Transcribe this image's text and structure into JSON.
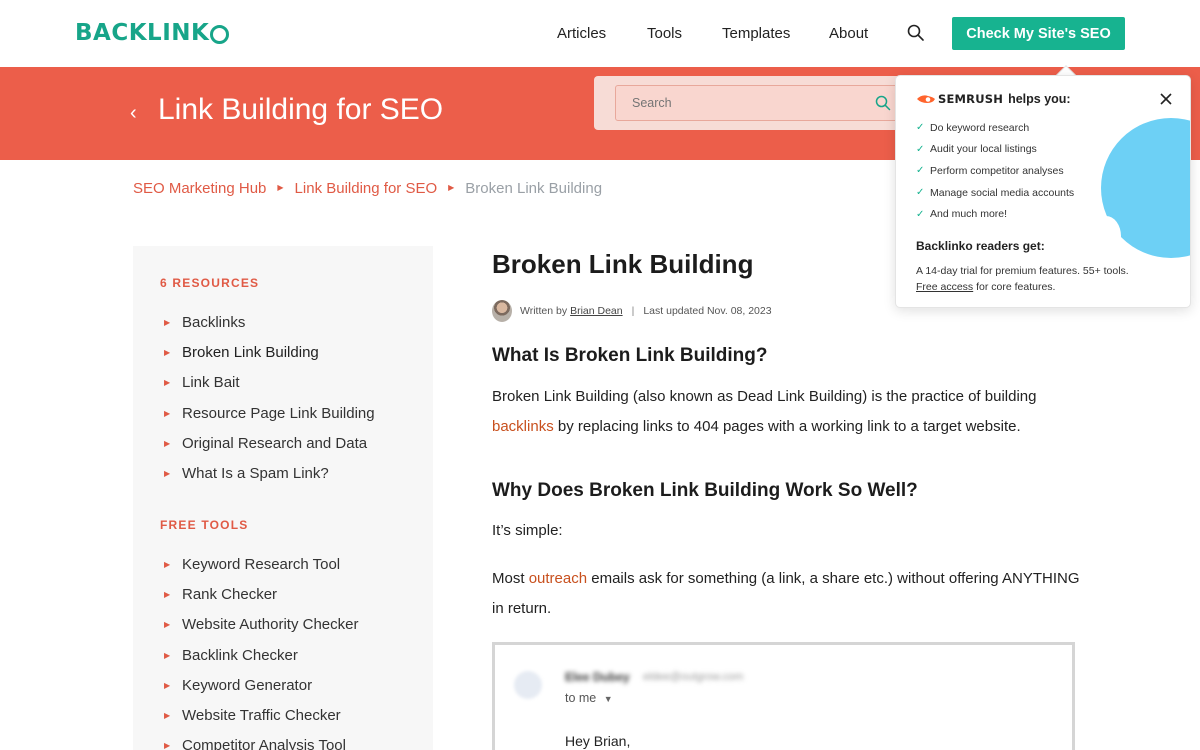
{
  "header": {
    "logo": "BACKLINK",
    "nav": [
      "Articles",
      "Tools",
      "Templates",
      "About"
    ],
    "cta_label": "Check My Site's SEO",
    "colors": {
      "brand": "#17a589",
      "cta": "#17b390",
      "hero": "#ec5e4a",
      "accent_link": "#c8501e"
    }
  },
  "hero": {
    "back_icon": "chevron-left-icon",
    "title": "Link Building for SEO",
    "search_placeholder": "Search"
  },
  "breadcrumb": {
    "items": [
      "SEO Marketing Hub",
      "Link Building for SEO"
    ],
    "current": "Broken Link Building"
  },
  "sidebar": {
    "resources_heading": "6 RESOURCES",
    "resources": [
      "Backlinks",
      "Broken Link Building",
      "Link Bait",
      "Resource Page Link Building",
      "Original Research and Data",
      "What Is a Spam Link?"
    ],
    "tools_heading": "FREE TOOLS",
    "tools": [
      "Keyword Research Tool",
      "Rank Checker",
      "Website Authority Checker",
      "Backlink Checker",
      "Keyword Generator",
      "Website Traffic Checker",
      "Competitor Analysis Tool"
    ]
  },
  "article": {
    "title": "Broken Link Building",
    "byline": {
      "written_by": "Written by",
      "author": "Brian Dean",
      "separator": "|",
      "updated": "Last updated Nov. 08, 2023"
    },
    "h2_1": "What Is Broken Link Building?",
    "p1_start": "Broken Link Building (also known as Dead Link Building) is the practice of building",
    "p1_link": "backlinks",
    "p1_end": " by replacing links to 404 pages with a working link to a target website.",
    "h2_2": "Why Does Broken Link Building Work So Well?",
    "p2": "It’s simple:",
    "p3_start": "Most ",
    "p3_link": "outreach",
    "p3_end": " emails ask for something (a link, a share etc.) without offering ANYTHING in return.",
    "email": {
      "sender": "Elee Dubey",
      "address": "eldee@outgrow.com",
      "to": "to me",
      "greeting": "Hey Brian,"
    }
  },
  "popover": {
    "brand": "SEMRUSH",
    "helps": "helps you:",
    "items": [
      "Do keyword research",
      "Audit your local listings",
      "Perform competitor analyses",
      "Manage social media accounts",
      "And much more!"
    ],
    "readers_heading": "Backlinko readers get:",
    "desc_line1": "A 14-day trial for premium features. 55+ tools.",
    "desc_link": "Free access",
    "desc_line2_end": " for core features."
  }
}
